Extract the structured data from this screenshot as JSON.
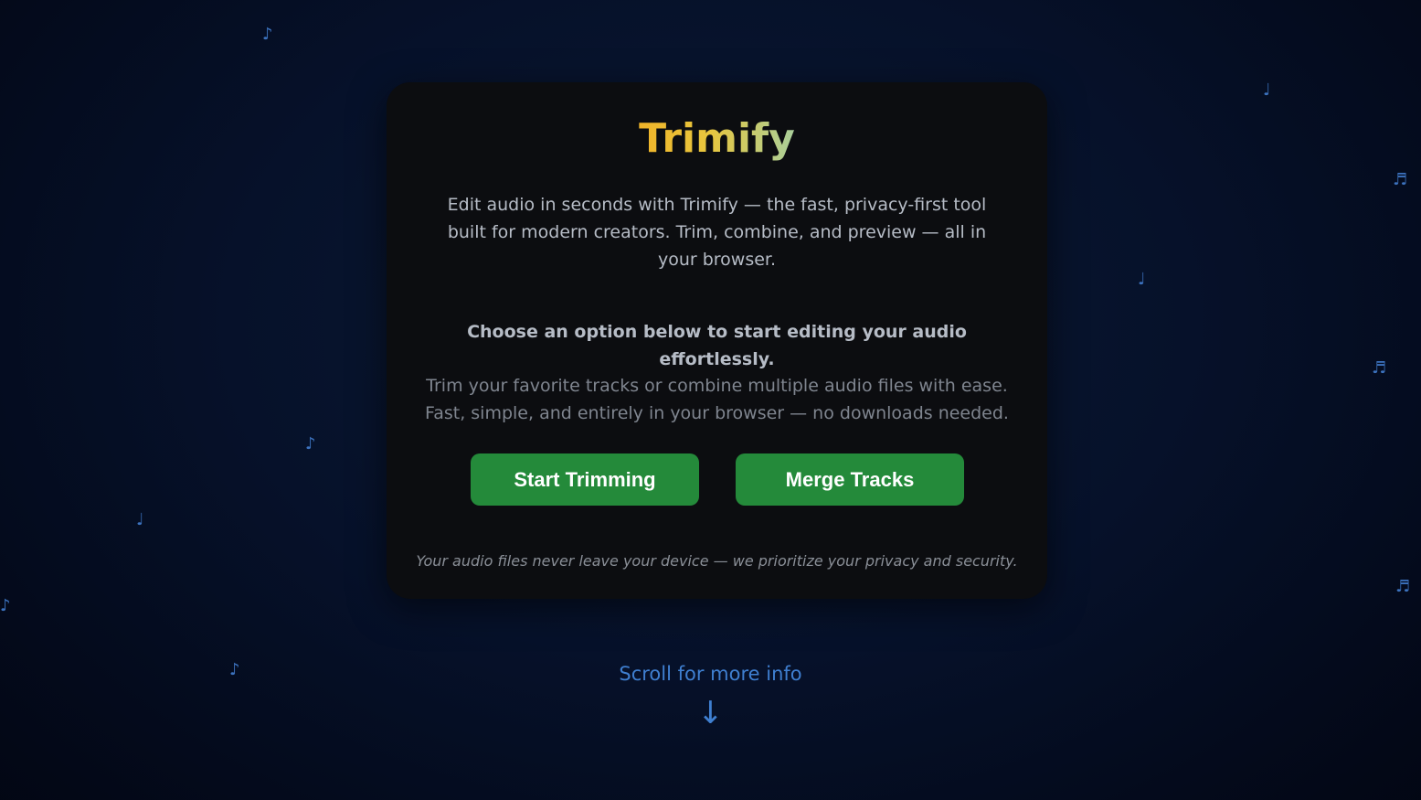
{
  "app": {
    "title": "Trimify",
    "description": "Edit audio in seconds with Trimify — the fast, privacy-first tool built for modern creators. Trim, combine, and preview — all in your browser.",
    "choose_text": "Choose an option below to start editing your audio effortlessly.",
    "sub_text": "Trim your favorite tracks or combine multiple audio files with ease. Fast, simple, and entirely in your browser — no downloads needed.",
    "privacy_note": "Your audio files never leave your device — we prioritize your privacy and security."
  },
  "actions": {
    "trim_label": "Start Trimming",
    "merge_label": "Merge Tracks"
  },
  "scroll": {
    "label": "Scroll for more info",
    "arrow": "↓"
  },
  "background_notes": {
    "eighth": "♪",
    "quarter": "♩",
    "beamed": "♬"
  },
  "colors": {
    "button": "#248a3a",
    "accent_link": "#3f7fd0",
    "title_gradient_start": "#f0b429",
    "title_gradient_end": "#a9cf9b",
    "note": "#3f78c7"
  }
}
